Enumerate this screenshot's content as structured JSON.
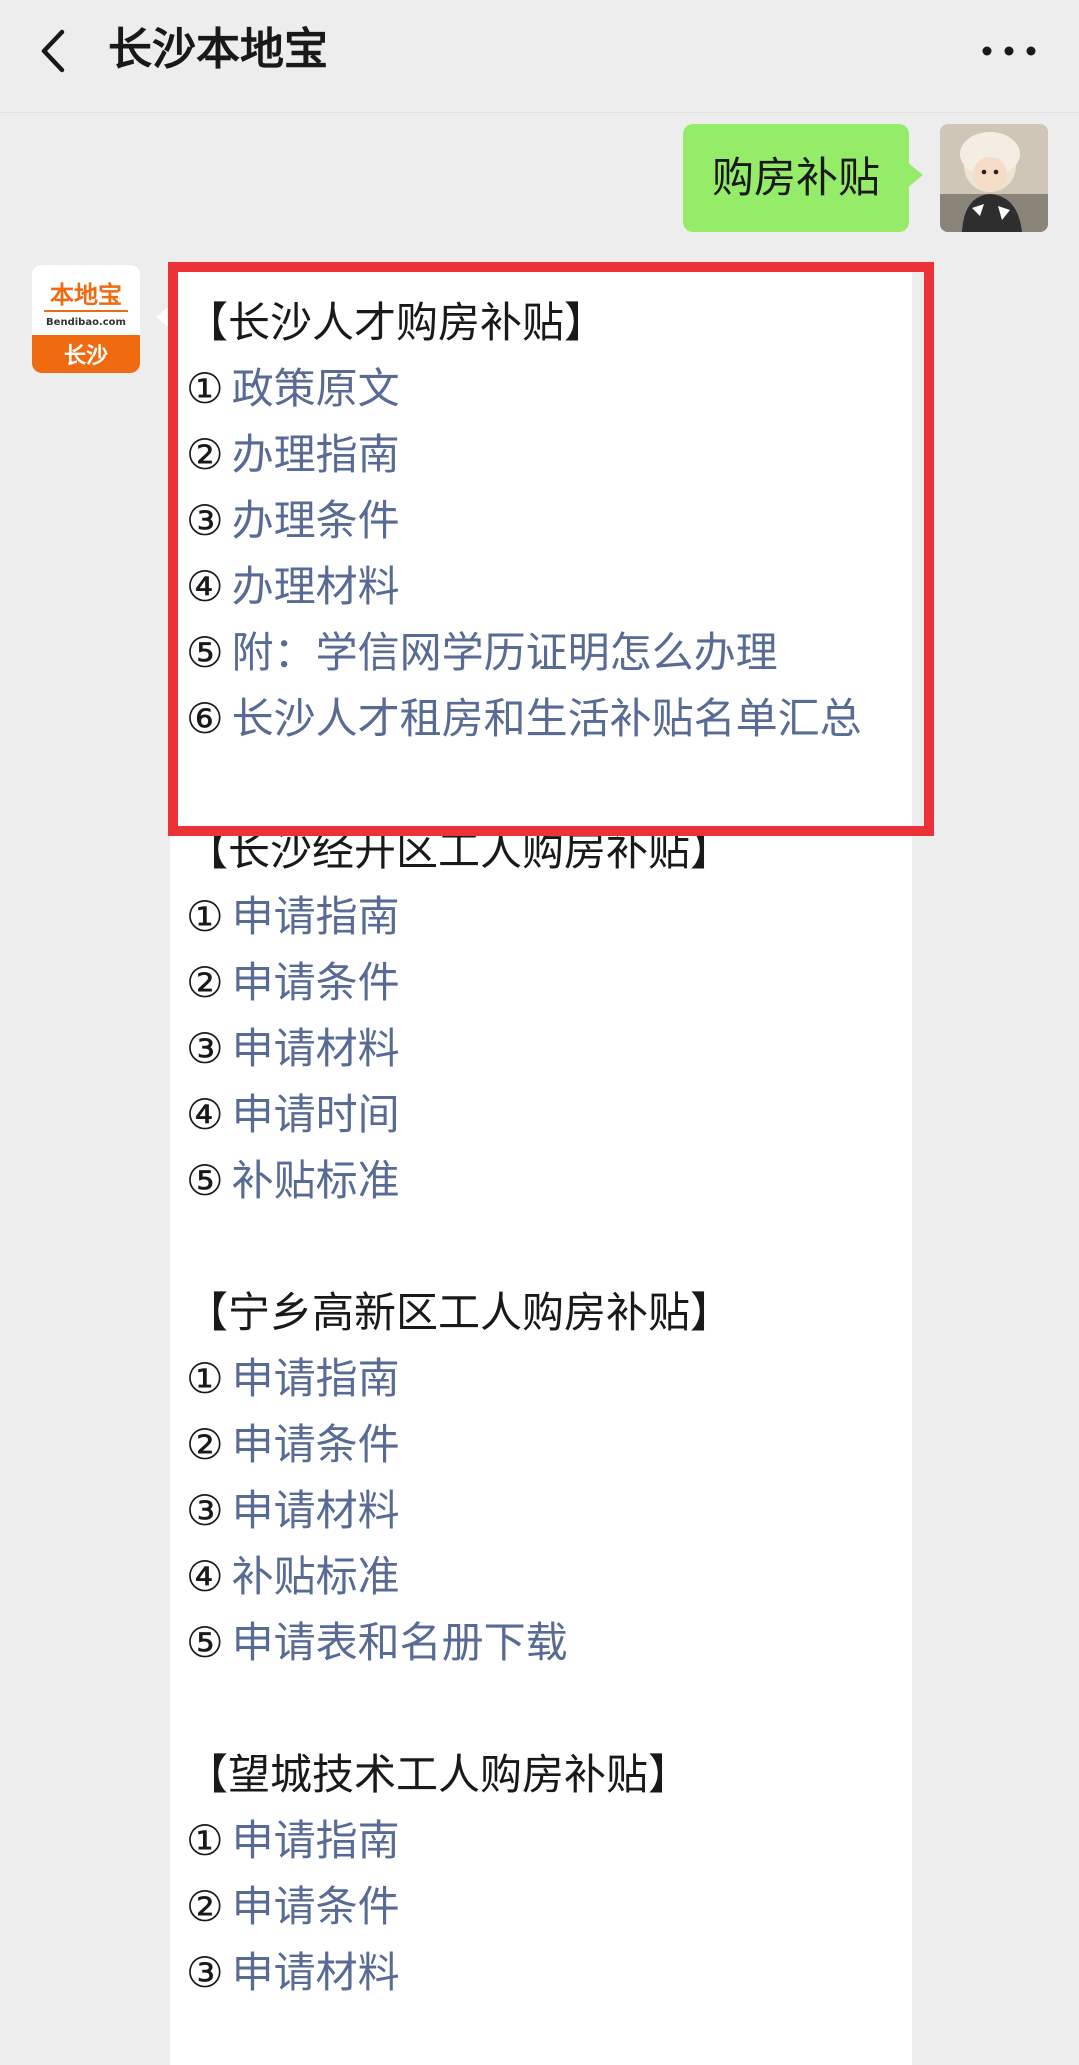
{
  "header": {
    "title": "长沙本地宝"
  },
  "user_message": {
    "text": "购房补贴"
  },
  "bot_avatar": {
    "logo_text": "本地宝",
    "logo_sub": "Bendibao.com",
    "city": "长沙"
  },
  "reply": {
    "sections": [
      {
        "title": "【长沙人才购房补贴】",
        "items": [
          {
            "num": "①",
            "label": "政策原文"
          },
          {
            "num": "②",
            "label": "办理指南"
          },
          {
            "num": "③",
            "label": "办理条件"
          },
          {
            "num": "④",
            "label": "办理材料"
          },
          {
            "num": "⑤",
            "label": "附：学信网学历证明怎么办理"
          },
          {
            "num": "⑥",
            "label": "长沙人才租房和生活补贴名单汇总"
          }
        ]
      },
      {
        "title": "【长沙经开区工人购房补贴】",
        "items": [
          {
            "num": "①",
            "label": "申请指南"
          },
          {
            "num": "②",
            "label": "申请条件"
          },
          {
            "num": "③",
            "label": "申请材料"
          },
          {
            "num": "④",
            "label": "申请时间"
          },
          {
            "num": "⑤",
            "label": "补贴标准"
          }
        ]
      },
      {
        "title": "【宁乡高新区工人购房补贴】",
        "items": [
          {
            "num": "①",
            "label": "申请指南"
          },
          {
            "num": "②",
            "label": "申请条件"
          },
          {
            "num": "③",
            "label": "申请材料"
          },
          {
            "num": "④",
            "label": "补贴标准"
          },
          {
            "num": "⑤",
            "label": "申请表和名册下载"
          }
        ]
      },
      {
        "title": "【望城技术工人购房补贴】",
        "items": [
          {
            "num": "①",
            "label": "申请指南"
          },
          {
            "num": "②",
            "label": "申请条件"
          },
          {
            "num": "③",
            "label": "申请材料"
          }
        ]
      }
    ]
  },
  "colors": {
    "background": "#ededed",
    "user_bubble": "#95ec69",
    "link": "#576b95",
    "highlight_border": "#ec3237",
    "logo_orange": "#f06a10"
  }
}
